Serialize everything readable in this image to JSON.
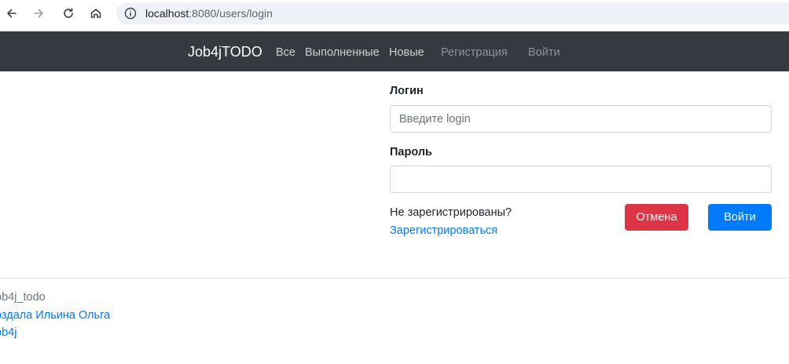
{
  "browser": {
    "url_host": "localhost",
    "url_rest": ":8080/users/login"
  },
  "navbar": {
    "brand": "Job4jTODO",
    "links": [
      {
        "label": "Все"
      },
      {
        "label": "Выполненные"
      },
      {
        "label": "Новые"
      },
      {
        "label": "Регистрация"
      },
      {
        "label": "Войти"
      }
    ]
  },
  "form": {
    "login_label": "Логин",
    "login_placeholder": "Введите login",
    "login_value": "",
    "password_label": "Пароль",
    "password_value": "",
    "not_registered_text": "Не зарегистрированы?",
    "register_link": "Зарегистрироваться",
    "cancel_button": "Отмена",
    "submit_button": "Войти"
  },
  "footer": {
    "project_name": "ob4j_todo",
    "author_link": "оздала Ильина Ольга",
    "org_link": "ob4j"
  },
  "colors": {
    "navbar_bg": "#343a40",
    "primary": "#007bff",
    "danger": "#dc3545"
  }
}
